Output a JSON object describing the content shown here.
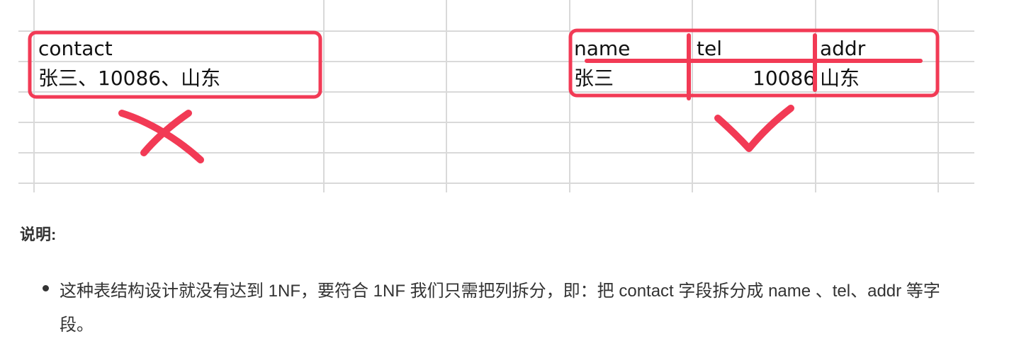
{
  "spreadsheet": {
    "left_example": {
      "header": "contact",
      "value": "张三、10086、山东"
    },
    "right_example": {
      "headers": [
        "name",
        "tel",
        "addr"
      ],
      "values": [
        "张三",
        "10086",
        "山东"
      ]
    },
    "colors": {
      "grid": "#d9d9d9",
      "annotation": "#f23a55"
    }
  },
  "explanation": {
    "title": "说明:",
    "items": [
      "这种表结构设计就没有达到 1NF，要符合 1NF 我们只需把列拆分，即：把 contact 字段拆分成 name 、tel、addr 等字段。"
    ]
  }
}
